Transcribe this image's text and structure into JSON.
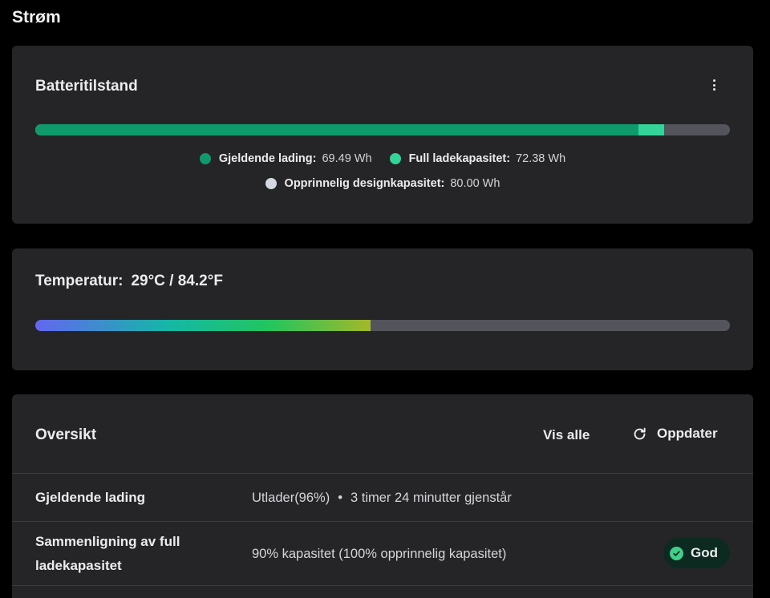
{
  "page": {
    "title": "Strøm"
  },
  "battery": {
    "title": "Batteritilstand",
    "bar": {
      "current_wh": 69.49,
      "full_wh": 72.38,
      "design_wh": 80.0
    },
    "legend": [
      {
        "label": "Gjeldende lading:",
        "value": "69.49 Wh",
        "color": "#0f9a6b"
      },
      {
        "label": "Full ladekapasitet:",
        "value": "72.38 Wh",
        "color": "#34d399"
      },
      {
        "label": "Opprinnelig designkapasitet:",
        "value": "80.00 Wh",
        "color": "#d4d8e2"
      }
    ]
  },
  "temperature": {
    "label": "Temperatur:",
    "value": "29°C / 84.2°F",
    "fill_fraction": 0.483
  },
  "overview": {
    "title": "Oversikt",
    "view_all": "Vis alle",
    "refresh": "Oppdater",
    "rows": [
      {
        "label": "Gjeldende lading",
        "status": "Utlader(96%)",
        "bullet": "•",
        "remaining": "3 timer 24 minutter gjenstår"
      },
      {
        "label": "Sammenligning av full ladekapasitet",
        "value": "90% kapasitet (100% opprinnelig kapasitet)",
        "badge": "God",
        "badge_color": "#3fd08a"
      }
    ]
  }
}
